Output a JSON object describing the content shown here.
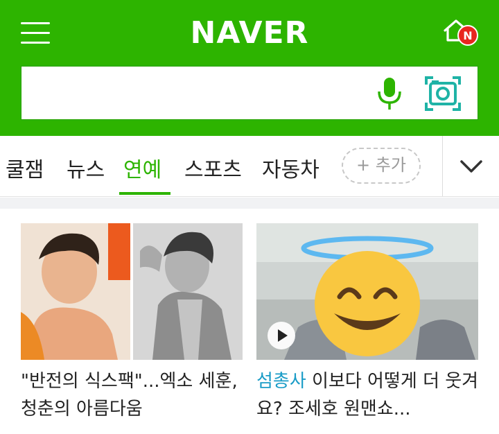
{
  "header": {
    "logo": "NAVER",
    "notification_badge": "N",
    "brand_color": "#2DB400"
  },
  "search": {
    "value": "",
    "placeholder": "",
    "mic_icon": "microphone-icon",
    "lens_icon": "camera-lens-icon"
  },
  "tabs": {
    "items": [
      "쿨잼",
      "뉴스",
      "연예",
      "스포츠",
      "자동차"
    ],
    "active": "연예",
    "add_label": "+ 추가",
    "expand_icon": "chevron-down-icon"
  },
  "articles": [
    {
      "title": "\"반전의 식스팩\"...엑소 세훈, 청춘의 아름다움"
    },
    {
      "press": "섬총사",
      "title": " 이보다 어떻게 더 웃겨요? 조세호 원맨쇼...",
      "overlay_icon": "halo-smiling-face-emoji",
      "play_icon": "play-icon"
    }
  ]
}
